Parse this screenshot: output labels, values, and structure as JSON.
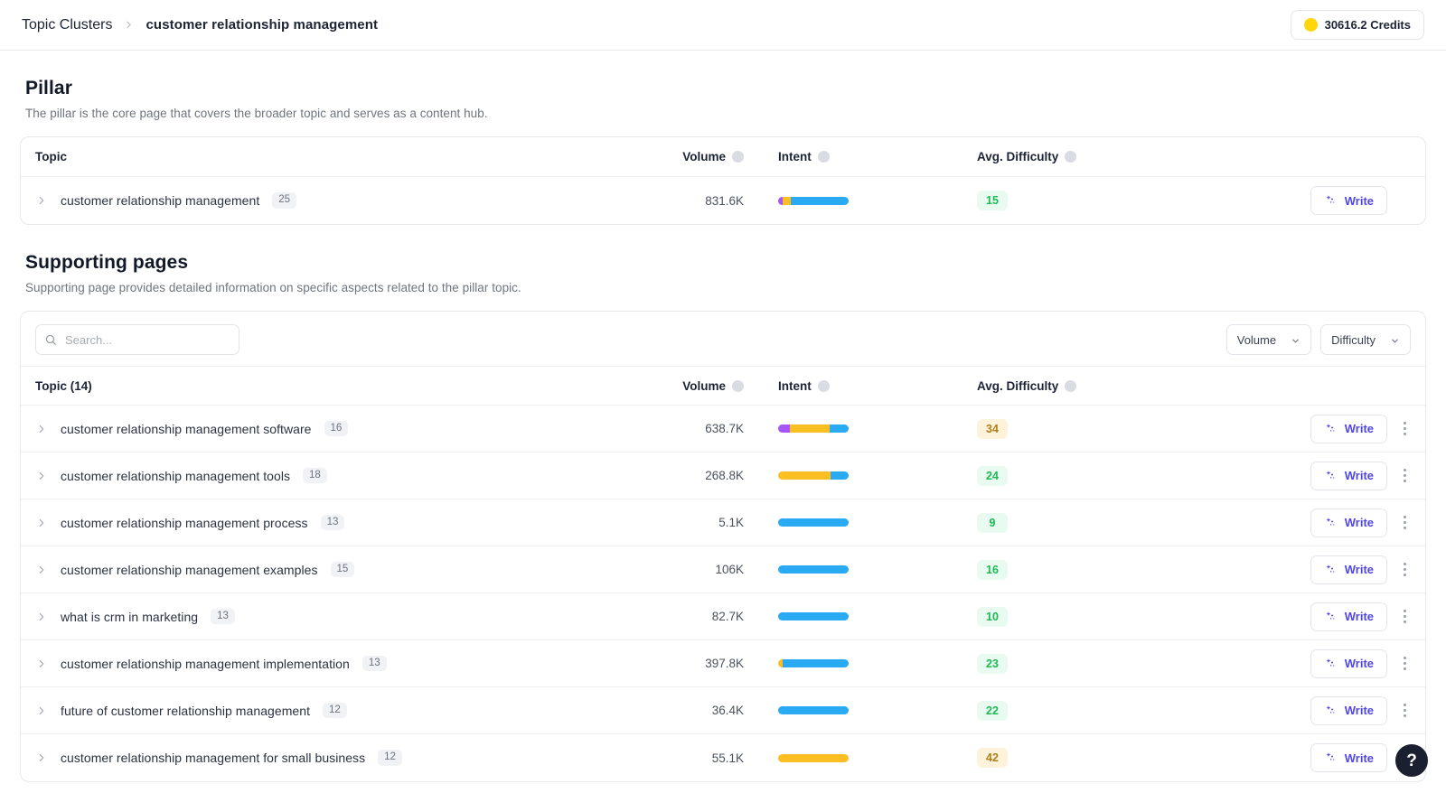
{
  "topbar": {
    "breadcrumb_root": "Topic Clusters",
    "breadcrumb_current": "customer relationship management",
    "credits_label": "30616.2 Credits",
    "coin_color": "#ffd60a"
  },
  "pillar": {
    "title": "Pillar",
    "subtitle": "The pillar is the core page that covers the broader topic and serves as a content hub.",
    "columns": {
      "topic": "Topic",
      "volume": "Volume",
      "intent": "Intent",
      "difficulty": "Avg. Difficulty"
    },
    "rows": [
      {
        "topic": "customer relationship management",
        "count": "25",
        "volume": "831.6K",
        "intent": [
          {
            "color": "#a855f7",
            "pct": 7
          },
          {
            "color": "#fbbf24",
            "pct": 11
          },
          {
            "color": "#29aaf3",
            "pct": 82
          }
        ],
        "difficulty": "15",
        "difficulty_level": "easy",
        "write_label": "Write"
      }
    ]
  },
  "supporting": {
    "title": "Supporting pages",
    "subtitle": "Supporting page provides detailed information on specific aspects related to the pillar topic.",
    "search_placeholder": "Search...",
    "search_value": "",
    "filters": [
      {
        "label": "Volume"
      },
      {
        "label": "Difficulty"
      }
    ],
    "columns": {
      "topic": "Topic (14)",
      "volume": "Volume",
      "intent": "Intent",
      "difficulty": "Avg. Difficulty"
    },
    "write_label": "Write",
    "rows": [
      {
        "topic": "customer relationship management software",
        "count": "16",
        "volume": "638.7K",
        "intent": [
          {
            "color": "#a855f7",
            "pct": 17
          },
          {
            "color": "#fbbf24",
            "pct": 56
          },
          {
            "color": "#29aaf3",
            "pct": 27
          }
        ],
        "difficulty": "34",
        "difficulty_level": "medium"
      },
      {
        "topic": "customer relationship management tools",
        "count": "18",
        "volume": "268.8K",
        "intent": [
          {
            "color": "#fbbf24",
            "pct": 74
          },
          {
            "color": "#29aaf3",
            "pct": 26
          }
        ],
        "difficulty": "24",
        "difficulty_level": "easy"
      },
      {
        "topic": "customer relationship management process",
        "count": "13",
        "volume": "5.1K",
        "intent": [
          {
            "color": "#29aaf3",
            "pct": 100
          }
        ],
        "difficulty": "9",
        "difficulty_level": "easy"
      },
      {
        "topic": "customer relationship management examples",
        "count": "15",
        "volume": "106K",
        "intent": [
          {
            "color": "#29aaf3",
            "pct": 100
          }
        ],
        "difficulty": "16",
        "difficulty_level": "easy"
      },
      {
        "topic": "what is crm in marketing",
        "count": "13",
        "volume": "82.7K",
        "intent": [
          {
            "color": "#29aaf3",
            "pct": 100
          }
        ],
        "difficulty": "10",
        "difficulty_level": "easy"
      },
      {
        "topic": "customer relationship management implementation",
        "count": "13",
        "volume": "397.8K",
        "intent": [
          {
            "color": "#fbbf24",
            "pct": 7
          },
          {
            "color": "#29aaf3",
            "pct": 93
          }
        ],
        "difficulty": "23",
        "difficulty_level": "easy"
      },
      {
        "topic": "future of customer relationship management",
        "count": "12",
        "volume": "36.4K",
        "intent": [
          {
            "color": "#29aaf3",
            "pct": 100
          }
        ],
        "difficulty": "22",
        "difficulty_level": "easy"
      },
      {
        "topic": "customer relationship management for small business",
        "count": "12",
        "volume": "55.1K",
        "intent": [
          {
            "color": "#fbbf24",
            "pct": 100
          }
        ],
        "difficulty": "42",
        "difficulty_level": "medium"
      }
    ]
  },
  "help": {
    "label": "?"
  }
}
